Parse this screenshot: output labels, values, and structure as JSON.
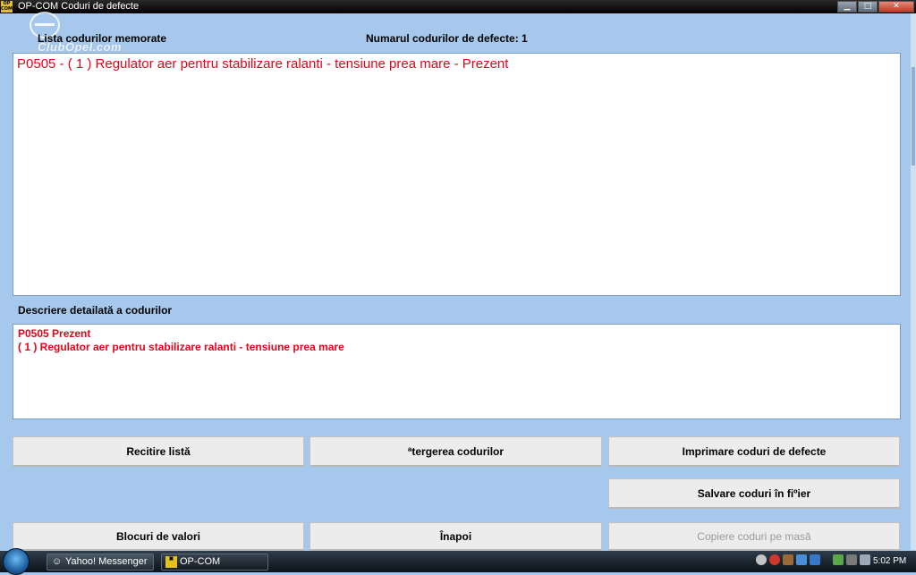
{
  "window": {
    "icon_text": "OP COM",
    "title": "OP-COM   Coduri de defecte",
    "controls": {
      "minimize": "▁",
      "maximize": "□",
      "close": "✕"
    }
  },
  "watermark": {
    "text": "ClubOpel.com"
  },
  "header": {
    "list_label": "Lista codurilor memorate",
    "count_label": "Numarul codurilor de defecte: 1"
  },
  "fault_list": {
    "items": [
      "P0505 - ( 1 )  Regulator aer pentru stabilizare ralanti - tensiune prea mare - Prezent"
    ]
  },
  "details": {
    "label": "Descriere detailată a codurilor",
    "lines": [
      "P0505  Prezent",
      "( 1 )  Regulator aer pentru stabilizare ralanti - tensiune prea mare"
    ]
  },
  "buttons": {
    "reread": "Recitire listă",
    "clear": "ªtergerea codurilor",
    "print": "Imprimare coduri de defecte",
    "save": "Salvare coduri în fiºier",
    "blocks": "Blocuri de valori",
    "back": "Înapoi",
    "copy": "Copiere coduri pe masă"
  },
  "taskbar": {
    "tasks": [
      {
        "label": "Yahoo! Messenger",
        "icon": "yahoo-messenger-icon"
      },
      {
        "label": "OP-COM",
        "icon": "opcom-icon"
      }
    ],
    "clock": "5:02 PM"
  },
  "colors": {
    "accent": "#e1061c",
    "background": "#a6c8ec"
  }
}
